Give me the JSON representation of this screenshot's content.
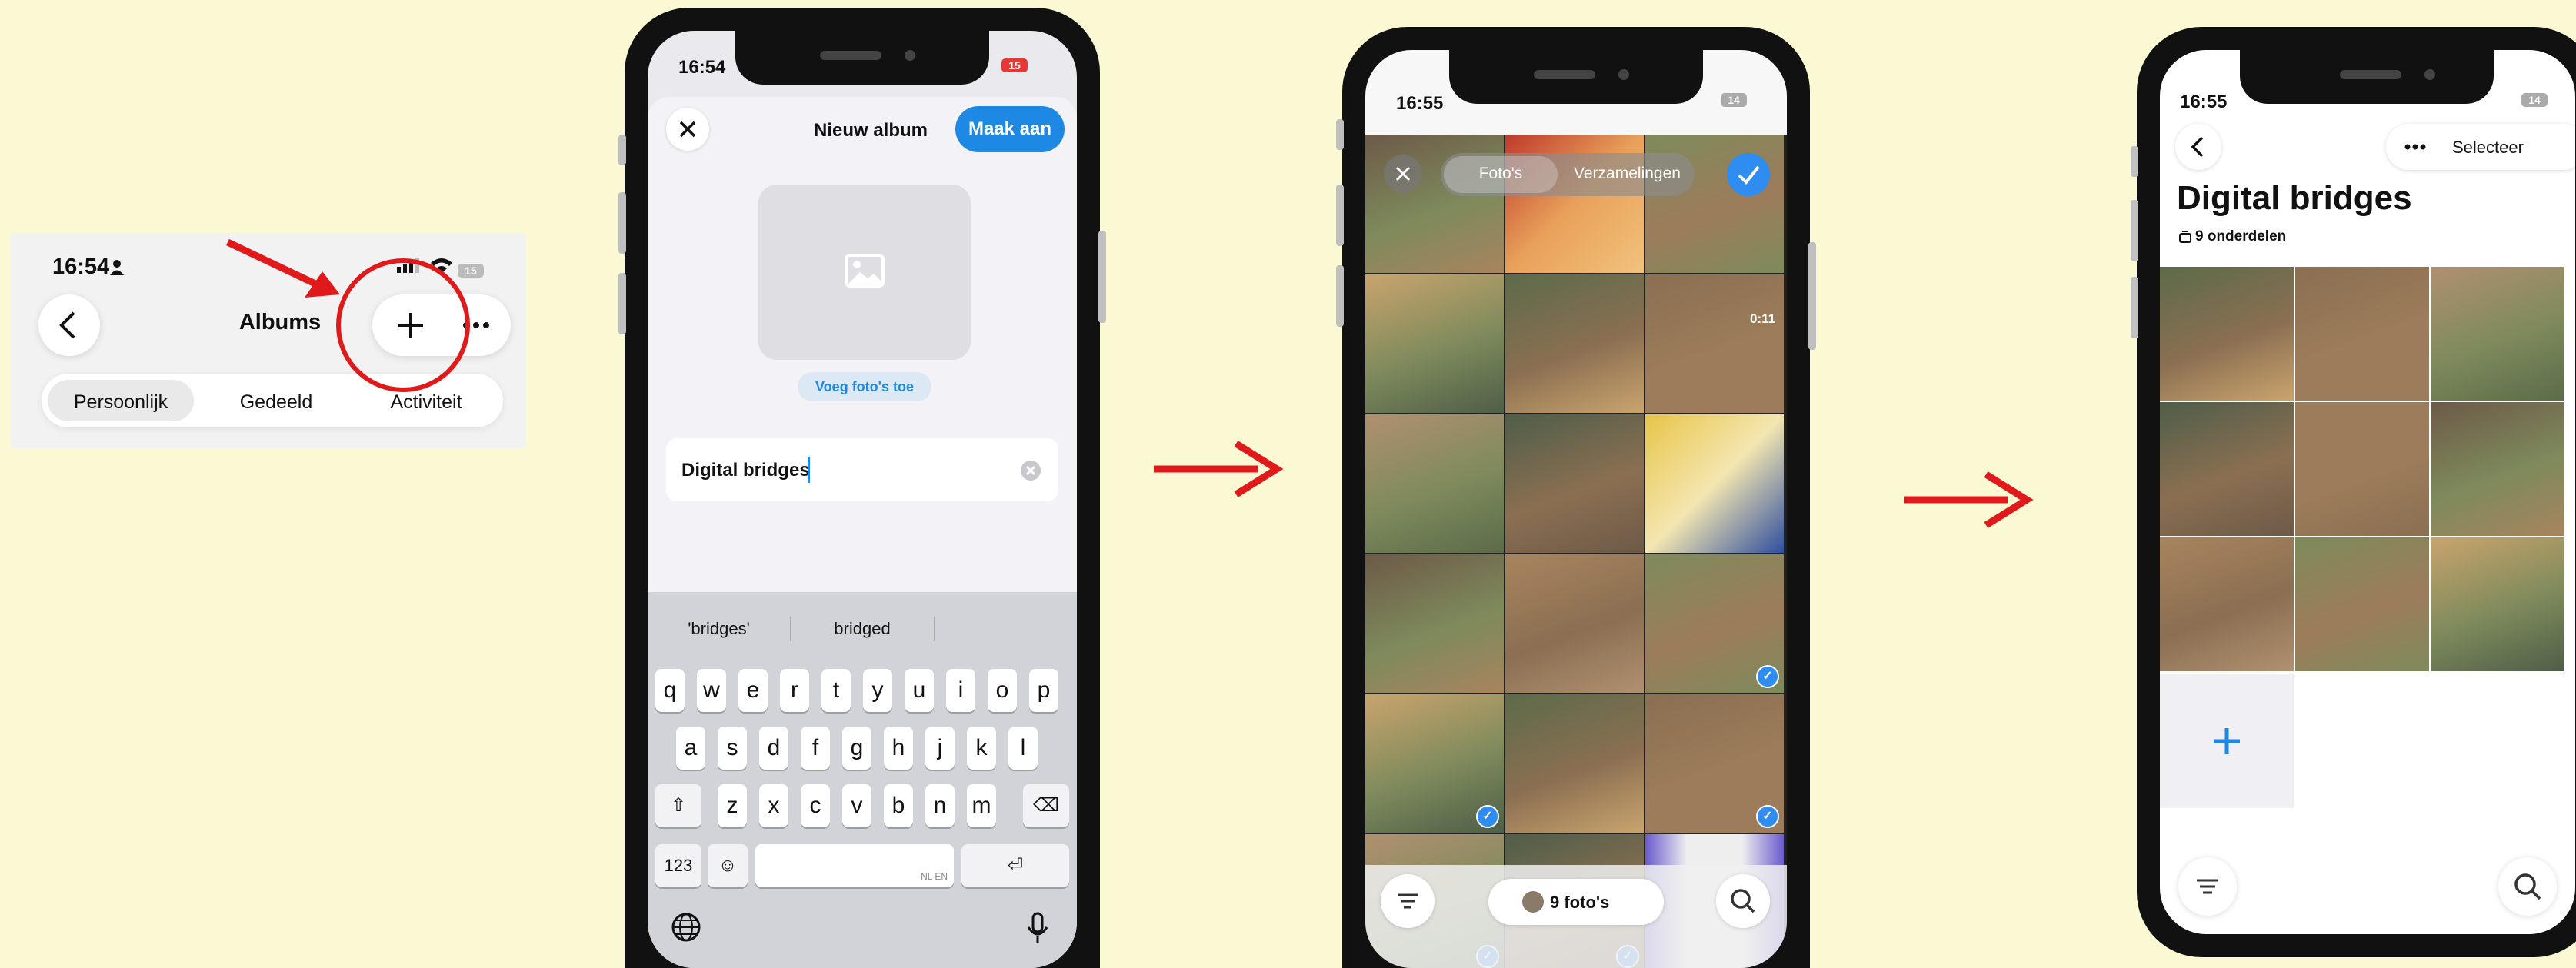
{
  "colors": {
    "background": "#fbf8d4",
    "accent": "#1e88e5",
    "annotation": "#e0191b"
  },
  "crop": {
    "time": "16:54",
    "title": "Albums",
    "battery": "15",
    "tabs": [
      "Persoonlijk",
      "Gedeeld",
      "Activiteit"
    ],
    "icons": [
      "back-chevron-icon",
      "plus-icon",
      "more-icon"
    ]
  },
  "phone2": {
    "time": "16:54",
    "battery": "15",
    "header": "Nieuw album",
    "create_button": "Maak aan",
    "add_photos": "Voeg foto's toe",
    "album_name": "Digital bridges",
    "suggestions": [
      "'bridges'",
      "bridged"
    ],
    "keys_row1": [
      "q",
      "w",
      "e",
      "r",
      "t",
      "y",
      "u",
      "i",
      "o",
      "p"
    ],
    "keys_row2": [
      "a",
      "s",
      "d",
      "f",
      "g",
      "h",
      "j",
      "k",
      "l"
    ],
    "keys_row3": [
      "z",
      "x",
      "c",
      "v",
      "b",
      "n",
      "m"
    ],
    "key_123": "123",
    "space_hint": "NL EN"
  },
  "phone3": {
    "time": "16:55",
    "battery": "14",
    "tab_photos": "Foto's",
    "tab_collections": "Verzamelingen",
    "video_duration": "0:11",
    "selection_count": "9 foto's"
  },
  "phone4": {
    "time": "16:55",
    "battery": "14",
    "select_button": "Selecteer",
    "album_title": "Digital bridges",
    "item_count": "9 onderdelen"
  }
}
